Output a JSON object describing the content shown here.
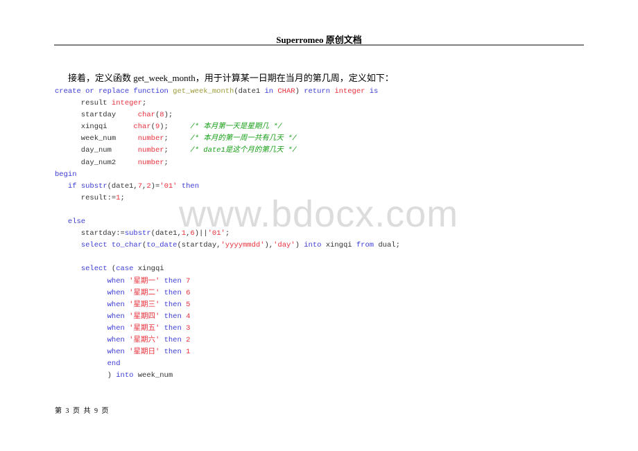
{
  "header": {
    "title": "Superromeo 原创文档"
  },
  "intro": "接着，定义函数 get_week_month，用于计算某一日期在当月的第几周，定义如下：",
  "watermark": "www.bdocx.com",
  "footer": "第 3 页 共 9 页",
  "code_lines": [
    [
      [
        "kw",
        "create or replace function "
      ],
      [
        "fn",
        "get_week_month"
      ],
      [
        "pl",
        "(date1 "
      ],
      [
        "kw",
        "in "
      ],
      [
        "ty",
        "CHAR"
      ],
      [
        "pl",
        ") "
      ],
      [
        "kw",
        "return "
      ],
      [
        "ty",
        "integer "
      ],
      [
        "kw",
        "is"
      ]
    ],
    [
      [
        "pl",
        "      result "
      ],
      [
        "ty",
        "integer"
      ],
      [
        "pl",
        ";"
      ]
    ],
    [
      [
        "pl",
        "      startday     "
      ],
      [
        "ty",
        "char"
      ],
      [
        "pl",
        "("
      ],
      [
        "num",
        "8"
      ],
      [
        "pl",
        ");"
      ]
    ],
    [
      [
        "pl",
        "      xingqi      "
      ],
      [
        "ty",
        "char"
      ],
      [
        "pl",
        "("
      ],
      [
        "num",
        "9"
      ],
      [
        "pl",
        ");     "
      ],
      [
        "cm",
        "/* 本月第一天是星期几 */"
      ]
    ],
    [
      [
        "pl",
        "      week_num     "
      ],
      [
        "ty",
        "number"
      ],
      [
        "pl",
        ";     "
      ],
      [
        "cm",
        "/* 本月的第一周一共有几天 */"
      ]
    ],
    [
      [
        "pl",
        "      day_num      "
      ],
      [
        "ty",
        "number"
      ],
      [
        "pl",
        ";     "
      ],
      [
        "cm",
        "/* date1是这个月的第几天 */"
      ]
    ],
    [
      [
        "pl",
        "      day_num2     "
      ],
      [
        "ty",
        "number"
      ],
      [
        "pl",
        ";"
      ]
    ],
    [
      [
        "kw",
        "begin"
      ]
    ],
    [
      [
        "pl",
        "   "
      ],
      [
        "kw",
        "if "
      ],
      [
        "kw",
        "substr"
      ],
      [
        "pl",
        "(date1,"
      ],
      [
        "num",
        "7"
      ],
      [
        "pl",
        ","
      ],
      [
        "num",
        "2"
      ],
      [
        "pl",
        ")="
      ],
      [
        "str",
        "'01'"
      ],
      [
        "pl",
        " "
      ],
      [
        "kw",
        "then"
      ]
    ],
    [
      [
        "pl",
        "      result:="
      ],
      [
        "num",
        "1"
      ],
      [
        "pl",
        ";"
      ]
    ],
    [
      [
        "pl",
        ""
      ]
    ],
    [
      [
        "pl",
        "   "
      ],
      [
        "kw",
        "else"
      ]
    ],
    [
      [
        "pl",
        "      startday:="
      ],
      [
        "kw",
        "substr"
      ],
      [
        "pl",
        "(date1,"
      ],
      [
        "num",
        "1"
      ],
      [
        "pl",
        ","
      ],
      [
        "num",
        "6"
      ],
      [
        "pl",
        ")||"
      ],
      [
        "str",
        "'01'"
      ],
      [
        "pl",
        ";"
      ]
    ],
    [
      [
        "pl",
        "      "
      ],
      [
        "kw",
        "select "
      ],
      [
        "kw",
        "to_char"
      ],
      [
        "pl",
        "("
      ],
      [
        "kw",
        "to_date"
      ],
      [
        "pl",
        "(startday,"
      ],
      [
        "str",
        "'yyyymmdd'"
      ],
      [
        "pl",
        "),"
      ],
      [
        "str",
        "'day'"
      ],
      [
        "pl",
        ") "
      ],
      [
        "kw",
        "into "
      ],
      [
        "pl",
        "xingqi "
      ],
      [
        "kw",
        "from "
      ],
      [
        "pl",
        "dual;"
      ]
    ],
    [
      [
        "pl",
        ""
      ]
    ],
    [
      [
        "pl",
        "      "
      ],
      [
        "kw",
        "select "
      ],
      [
        "pl",
        "("
      ],
      [
        "kw",
        "case "
      ],
      [
        "pl",
        "xingqi"
      ]
    ],
    [
      [
        "pl",
        "            "
      ],
      [
        "kw",
        "when "
      ],
      [
        "str",
        "'星期一'"
      ],
      [
        "pl",
        " "
      ],
      [
        "kw",
        "then "
      ],
      [
        "num",
        "7"
      ]
    ],
    [
      [
        "pl",
        "            "
      ],
      [
        "kw",
        "when "
      ],
      [
        "str",
        "'星期二'"
      ],
      [
        "pl",
        " "
      ],
      [
        "kw",
        "then "
      ],
      [
        "num",
        "6"
      ]
    ],
    [
      [
        "pl",
        "            "
      ],
      [
        "kw",
        "when "
      ],
      [
        "str",
        "'星期三'"
      ],
      [
        "pl",
        " "
      ],
      [
        "kw",
        "then "
      ],
      [
        "num",
        "5"
      ]
    ],
    [
      [
        "pl",
        "            "
      ],
      [
        "kw",
        "when "
      ],
      [
        "str",
        "'星期四'"
      ],
      [
        "pl",
        " "
      ],
      [
        "kw",
        "then "
      ],
      [
        "num",
        "4"
      ]
    ],
    [
      [
        "pl",
        "            "
      ],
      [
        "kw",
        "when "
      ],
      [
        "str",
        "'星期五'"
      ],
      [
        "pl",
        " "
      ],
      [
        "kw",
        "then "
      ],
      [
        "num",
        "3"
      ]
    ],
    [
      [
        "pl",
        "            "
      ],
      [
        "kw",
        "when "
      ],
      [
        "str",
        "'星期六'"
      ],
      [
        "pl",
        " "
      ],
      [
        "kw",
        "then "
      ],
      [
        "num",
        "2"
      ]
    ],
    [
      [
        "pl",
        "            "
      ],
      [
        "kw",
        "when "
      ],
      [
        "str",
        "'星期日'"
      ],
      [
        "pl",
        " "
      ],
      [
        "kw",
        "then "
      ],
      [
        "num",
        "1"
      ]
    ],
    [
      [
        "pl",
        "            "
      ],
      [
        "kw",
        "end"
      ]
    ],
    [
      [
        "pl",
        "            ) "
      ],
      [
        "kw",
        "into "
      ],
      [
        "pl",
        "week_num"
      ]
    ]
  ]
}
